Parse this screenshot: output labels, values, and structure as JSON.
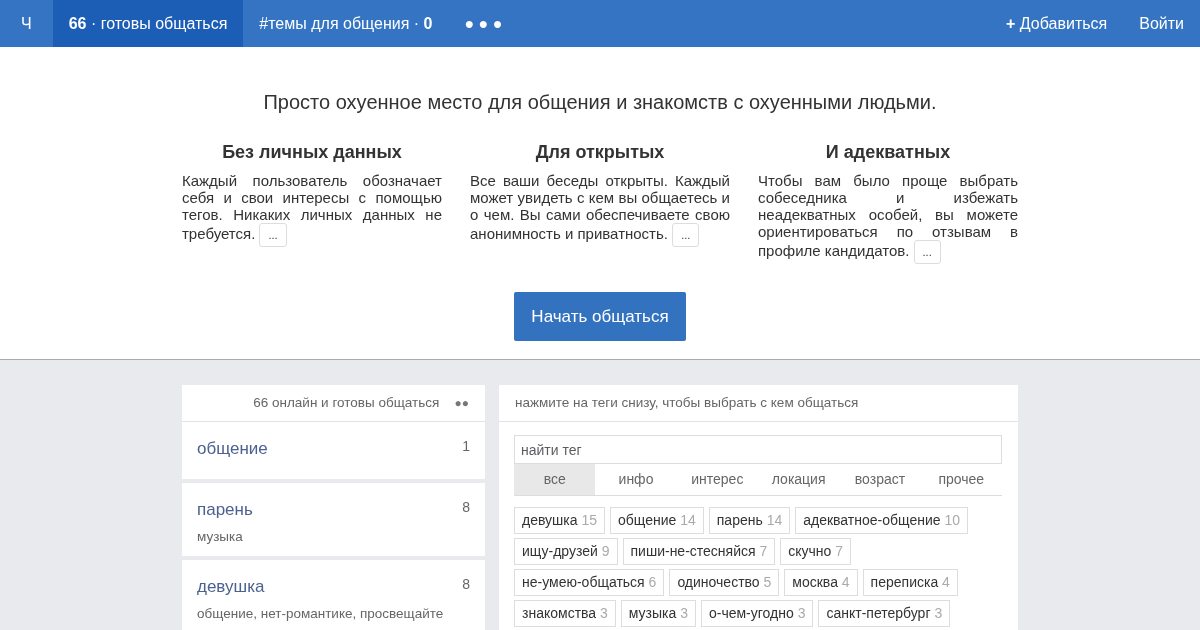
{
  "navbar": {
    "brand": "Ч",
    "items": [
      {
        "label": "**66** · готовы общаться",
        "selected": true
      },
      {
        "label": "#темы для общения · **0**",
        "selected": false
      },
      {
        "label": "● ● ●",
        "selected": false
      }
    ],
    "right_items": [
      {
        "label": "**+** Добавиться"
      },
      {
        "label": "Войти"
      }
    ]
  },
  "hero": {
    "tagline": "Просто охуенное место для общения и знакомств с охуенными людьми.",
    "features": [
      {
        "title": "Без личных данных",
        "text": "Каждый пользователь обозначает себя и свои интересы с помощью тегов. Никаких личных данных не требуется.",
        "more": "..."
      },
      {
        "title": "Для открытых",
        "text": "Все ваши беседы открыты. Каждый может увидеть с кем вы общаетесь и о чем. Вы сами обеспечиваете свою анонимность и приватность.",
        "more": "..."
      },
      {
        "title": "И адекватных",
        "text": "Чтобы вам было проще выбрать собеседника и избежать неадекватных особей, вы можете ориентироваться по отзывам в профиле кандидатов.",
        "more": "..."
      }
    ],
    "cta": "Начать общаться"
  },
  "online_panel": {
    "header": "66 онлайн и готовы общаться",
    "menu": "●●",
    "items": [
      {
        "tag": "общение",
        "count": "1"
      },
      {
        "tag": "парень",
        "count": "8",
        "subtitle": "музыка"
      },
      {
        "tag": "девушка",
        "count": "8",
        "subtitle": "общение, нет-романтике, просвещайте"
      }
    ]
  },
  "tags_panel": {
    "header": "нажмите на теги снизу, чтобы выбрать с кем общаться",
    "search": {
      "placeholder": "найти тег"
    },
    "tabs": [
      {
        "label": "все",
        "selected": true
      },
      {
        "label": "инфо",
        "selected": false
      },
      {
        "label": "интерес",
        "selected": false
      },
      {
        "label": "локация",
        "selected": false
      },
      {
        "label": "возраст",
        "selected": false
      },
      {
        "label": "прочее",
        "selected": false
      }
    ],
    "tags": [
      {
        "name": "девушка",
        "count": "15"
      },
      {
        "name": "общение",
        "count": "14"
      },
      {
        "name": "парень",
        "count": "14"
      },
      {
        "name": "адекватное-общение",
        "count": "10"
      },
      {
        "name": "ищу-друзей",
        "count": "9"
      },
      {
        "name": "пиши-не-стесняйся",
        "count": "7"
      },
      {
        "name": "скучно",
        "count": "7"
      },
      {
        "name": "не-умею-общаться",
        "count": "6"
      },
      {
        "name": "одиночество",
        "count": "5"
      },
      {
        "name": "москва",
        "count": "4"
      },
      {
        "name": "переписка",
        "count": "4"
      },
      {
        "name": "знакомства",
        "count": "3"
      },
      {
        "name": "музыка",
        "count": "3"
      },
      {
        "name": "о-чем-угодно",
        "count": "3"
      },
      {
        "name": "санкт-петербург",
        "count": "3"
      }
    ]
  }
}
